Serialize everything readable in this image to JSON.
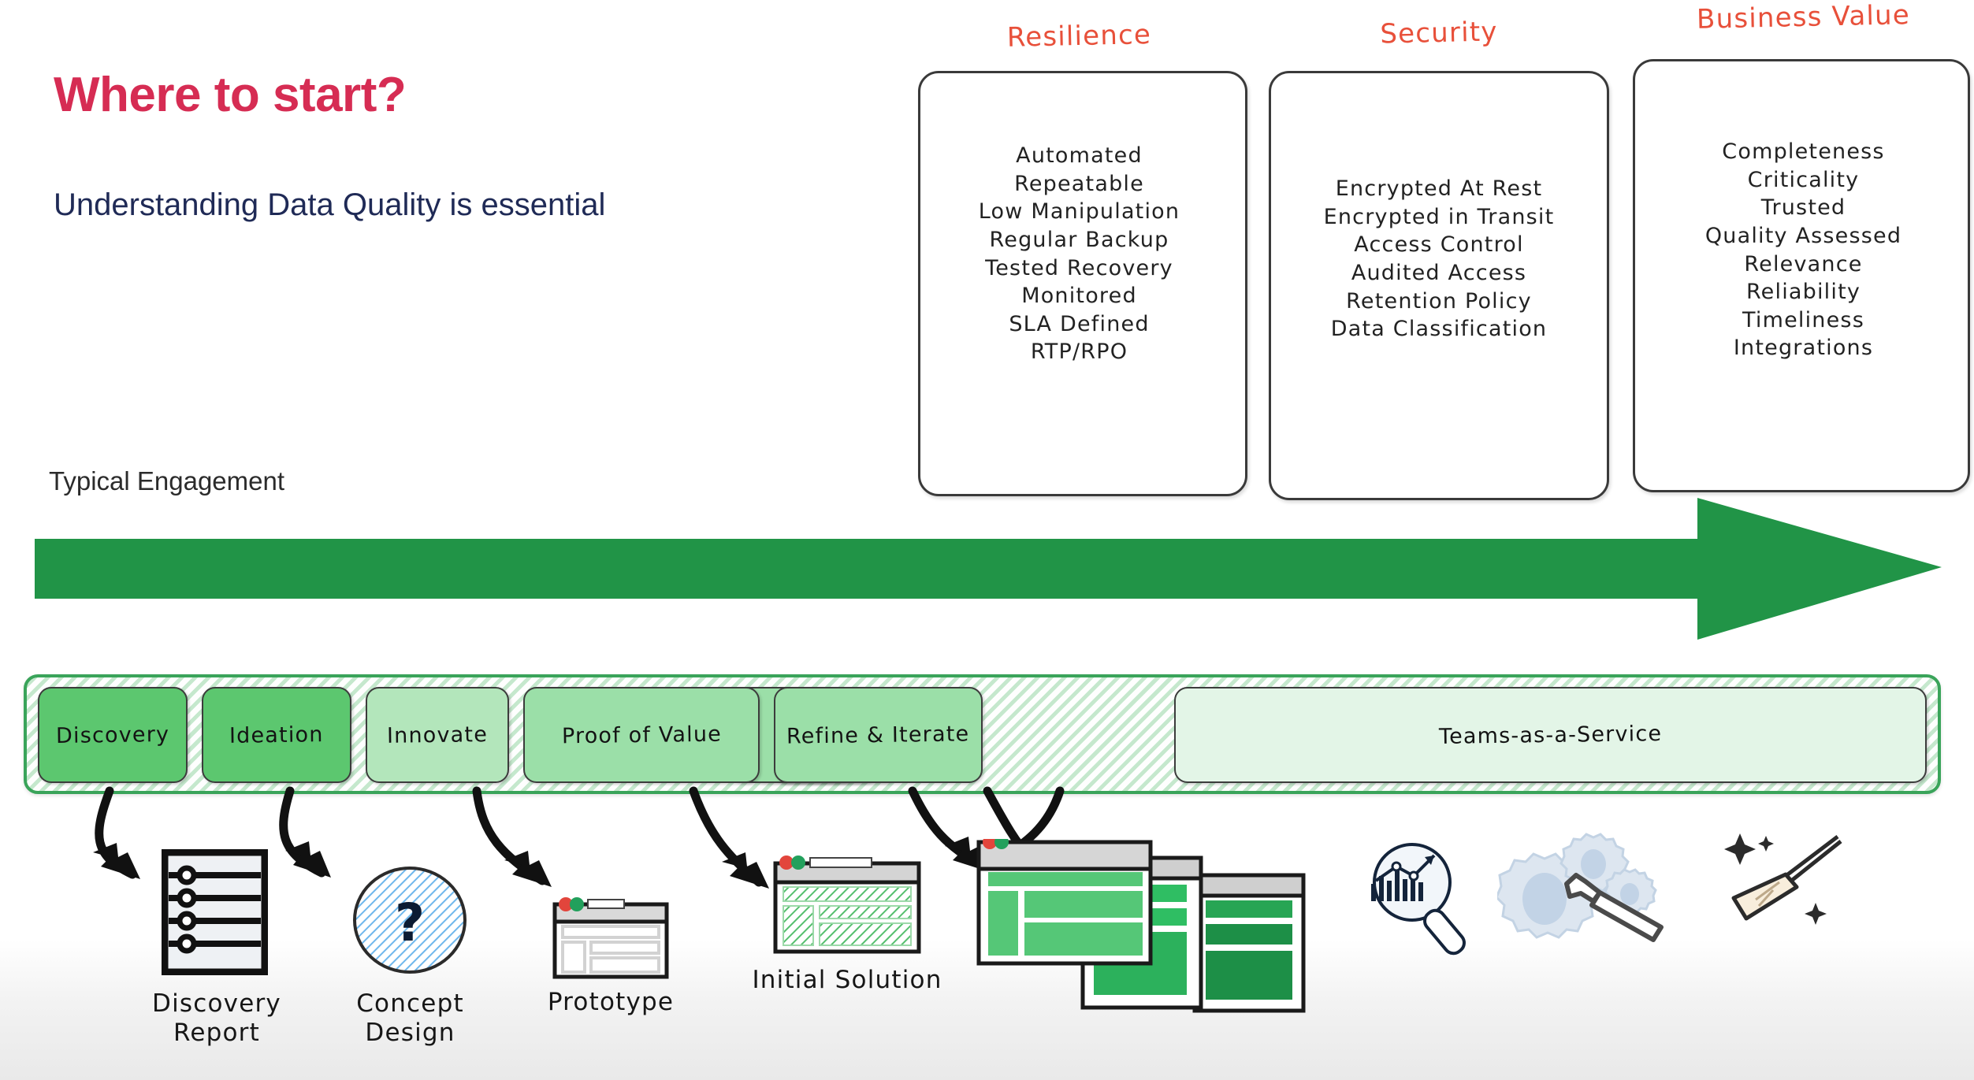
{
  "slide": {
    "title": "Where to start?",
    "subtitle": "Understanding Data Quality is essential",
    "engagement_label": "Typical Engagement"
  },
  "colors": {
    "title_red": "#d62c53",
    "subtitle_navy": "#1f2a56",
    "pillar_heading_red": "#e8503a",
    "arrow_green": "#219447",
    "bar_border_green": "#3aa45a",
    "card_dark_green": "#5cc76f",
    "card_mid_green": "#9bdfa8",
    "card_light_green": "#b3e6bb",
    "taas_green": "#e3f5e7"
  },
  "pillars": [
    {
      "id": "resilience",
      "title": "Resilience",
      "items": [
        "Automated",
        "Repeatable",
        "Low Manipulation",
        "Regular Backup",
        "Tested Recovery",
        "Monitored",
        "SLA Defined",
        "RTP/RPO"
      ]
    },
    {
      "id": "security",
      "title": "Security",
      "items": [
        "Encrypted At Rest",
        "Encrypted in Transit",
        "Access Control",
        "Audited Access",
        "Retention Policy",
        "Data Classification"
      ]
    },
    {
      "id": "business-value",
      "title": "Business Value",
      "items": [
        "Completeness",
        "Criticality",
        "Trusted",
        "Quality Assessed",
        "Relevance",
        "Reliability",
        "Timeliness",
        "Integrations"
      ]
    }
  ],
  "phases": [
    {
      "label": "Discovery",
      "color": "#5cc76f"
    },
    {
      "label": "Ideation",
      "color": "#5cc76f"
    },
    {
      "label": "Innovate",
      "color": "#b3e6bb"
    },
    {
      "label": "Proof of Value",
      "color": "#9bdfa8"
    },
    {
      "label": "Refine & Iterate",
      "color": "#9bdfa8"
    },
    {
      "label": "Teams-as-a-Service",
      "color": "#e3f5e7"
    }
  ],
  "artifacts": [
    {
      "id": "discovery-report",
      "label_line1": "Discovery",
      "label_line2": "Report",
      "icon": "checklist-document-icon"
    },
    {
      "id": "concept-design",
      "label_line1": "Concept",
      "label_line2": "Design",
      "icon": "question-mark-circle-icon"
    },
    {
      "id": "prototype",
      "label_line1": "Prototype",
      "label_line2": "",
      "icon": "wireframe-window-icon"
    },
    {
      "id": "initial-solution",
      "label_line1": "Initial Solution",
      "label_line2": "",
      "icon": "hatched-window-icon"
    },
    {
      "id": "final-solution",
      "label_line1": "",
      "label_line2": "",
      "icon": "stacked-windows-icon"
    }
  ],
  "service_icons": [
    {
      "id": "analytics-magnifier",
      "name": "chart-magnifier-icon"
    },
    {
      "id": "gears-wrench",
      "name": "gears-wrench-icon"
    },
    {
      "id": "broom-sparkle",
      "name": "broom-sparkle-icon"
    }
  ]
}
